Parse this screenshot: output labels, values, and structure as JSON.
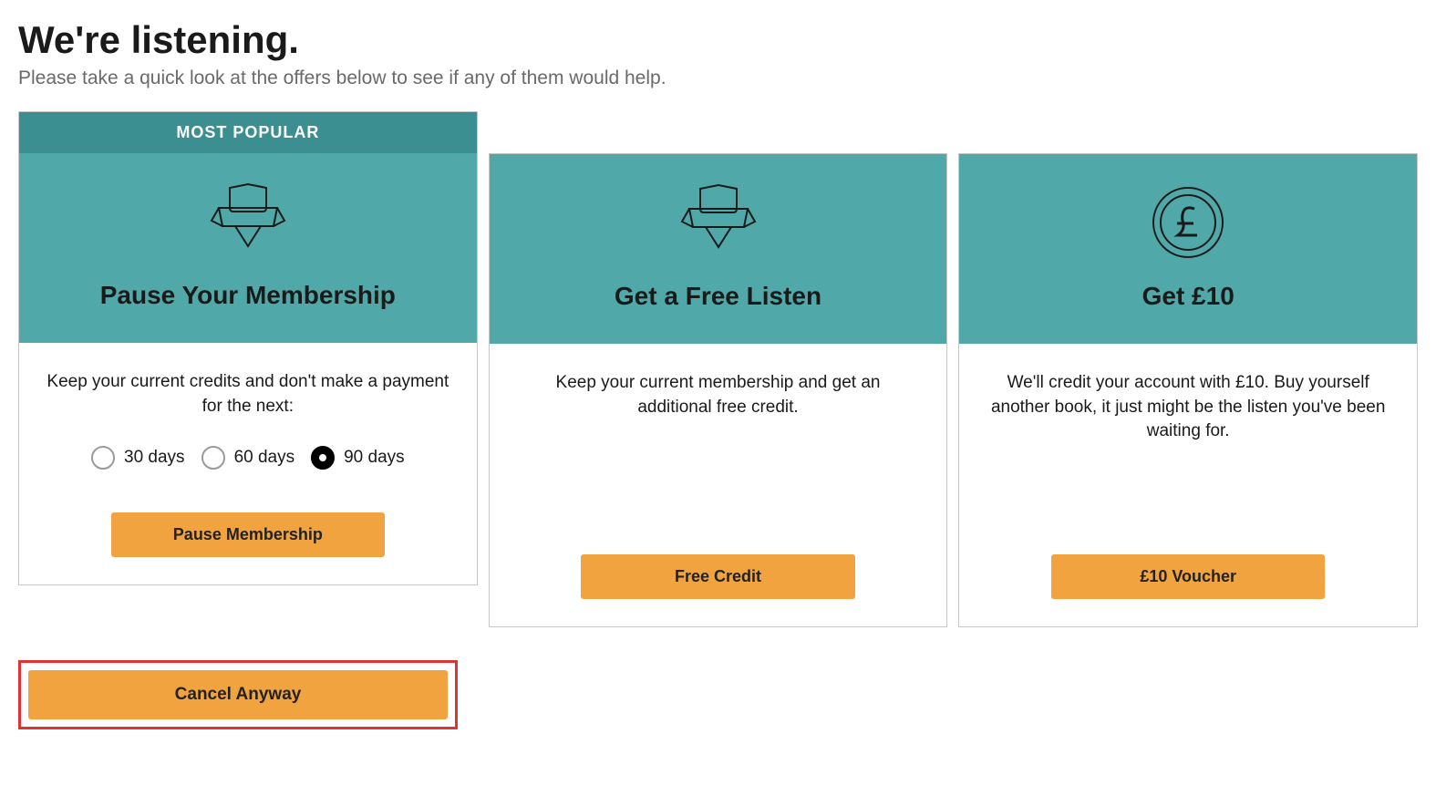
{
  "header": {
    "title": "We're listening.",
    "subtitle": "Please take a quick look at the offers below to see if any of them would help."
  },
  "cards": {
    "pause": {
      "popular_label": "MOST POPULAR",
      "title": "Pause Your Membership",
      "description": "Keep your current credits and don't make a payment for the next:",
      "options": {
        "a": "30 days",
        "b": "60 days",
        "c": "90 days"
      },
      "selected": "c",
      "cta": "Pause Membership"
    },
    "free": {
      "title": "Get a Free Listen",
      "description": "Keep your current membership and get an additional free credit.",
      "cta": "Free Credit"
    },
    "voucher": {
      "title": "Get £10",
      "description": "We'll credit your account with £10. Buy yourself another book, it just might be the listen you've been waiting for.",
      "cta": "£10 Voucher"
    }
  },
  "cancel": {
    "label": "Cancel Anyway"
  }
}
